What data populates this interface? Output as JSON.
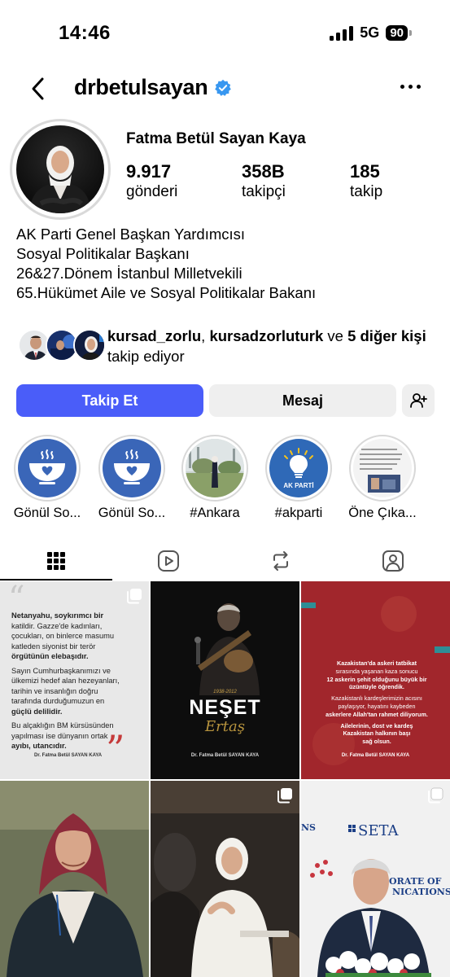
{
  "status_bar": {
    "time": "14:46",
    "network": "5G",
    "battery": "90"
  },
  "header": {
    "username": "drbetulsayan",
    "verified": true
  },
  "profile": {
    "name": "Fatma Betül Sayan Kaya",
    "stats": [
      {
        "value": "9.917",
        "label": "gönderi"
      },
      {
        "value": "358B",
        "label": "takipçi"
      },
      {
        "value": "185",
        "label": "takip"
      }
    ],
    "bio": [
      "AK Parti Genel Başkan Yardımcısı",
      "Sosyal Politikalar Başkanı",
      "26&27.Dönem İstanbul Milletvekili",
      "65.Hükümet Aile ve Sosyal Politikalar Bakanı"
    ]
  },
  "followed_by": {
    "user1": "kursad_zorlu",
    "separator": ", ",
    "user2": "kursadzorluturk",
    "and": " ve ",
    "others": "5 diğer kişi",
    "suffix": " takip ediyor"
  },
  "buttons": {
    "follow": "Takip Et",
    "message": "Mesaj"
  },
  "highlights": [
    {
      "label": "Gönül So...",
      "icon": "soup-bowl-heart-icon"
    },
    {
      "label": "Gönül So...",
      "icon": "soup-bowl-heart-icon"
    },
    {
      "label": "#Ankara",
      "icon": "photo"
    },
    {
      "label": "#akparti",
      "icon": "ak-parti-logo",
      "logo_text": "AK PARTİ"
    },
    {
      "label": "Öne Çıka...",
      "icon": "document-photo"
    }
  ],
  "tabs": [
    "grid-icon",
    "reels-icon",
    "reposts-icon",
    "tagged-icon"
  ],
  "posts": {
    "p1": {
      "lines": [
        "Netanyahu, soykırımcı bir",
        "katildir. Gazze'de kadınları,",
        "çocukları, on binlerce masumu",
        "katleden siyonist bir terör",
        "örgütünün elebaşıdır.",
        "Sayın Cumhurbaşkanımızı ve",
        "ülkemizi hedef alan hezeyanları,",
        "tarihin ve insanlığın doğru",
        "tarafında durduğumuzun en",
        "güçlü delilidir.",
        "Bu alçaklığın BM kürsüsünden",
        "yapılması ise dünyanın ortak",
        "ayıbı, utancıdır."
      ],
      "signature": "Dr. Fatma Betül SAYAN KAYA"
    },
    "p2": {
      "title": "NEŞET",
      "subtitle": "Ertaş",
      "years": "1938-2012",
      "signature": "Dr. Fatma Betül SAYAN KAYA"
    },
    "p3": {
      "lines": [
        "Kazakistan'da askeri tatbikat",
        "sırasında yaşanan kaza sonucu",
        "12 askerin şehit olduğunu büyük bir",
        "üzüntüyle öğrendik.",
        "Kazakistanlı kardeşlerimizin acısını",
        "paylaşıyor, hayatını kaybeden",
        "askerlere Allah'tan rahmet diliyorum.",
        "Ailelerinin, dost ve kardeş",
        "Kazakistan halkının başı",
        "sağ olsun."
      ],
      "signature": "Dr. Fatma Betül SAYAN KAYA"
    },
    "p6": {
      "logo": "SETA",
      "banner": "ORATE OF",
      "banner2": "NICATIONS"
    }
  },
  "colors": {
    "follow_button": "#4a5df9",
    "verified": "#3897f0",
    "ak_blue": "#2f69b7",
    "kz_red": "#a1262c"
  }
}
